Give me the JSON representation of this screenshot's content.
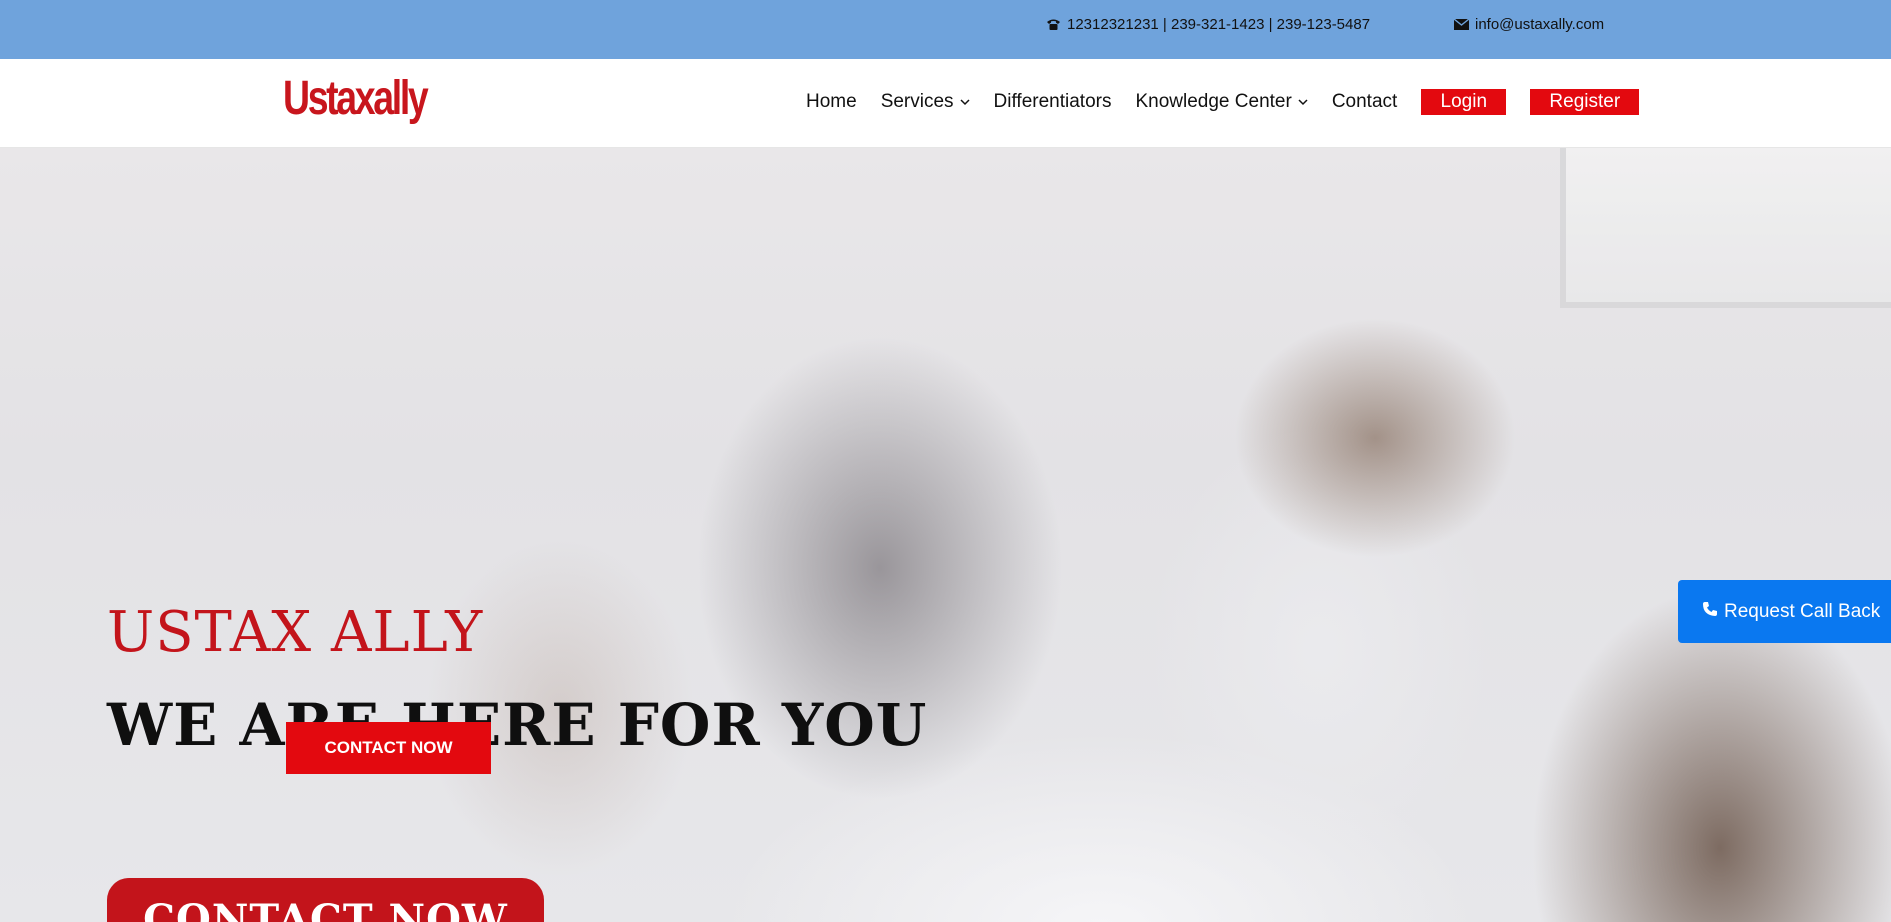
{
  "topbar": {
    "phones": "12312321231 | 239-321-1423 | 239-123-5487",
    "email": "info@ustaxally.com",
    "background_color": "#6fa3dc",
    "phone_icon": "phone-icon",
    "email_icon": "envelope-icon"
  },
  "brand": {
    "logo_text": "Ustaxally",
    "color": "#c8161d"
  },
  "nav": {
    "home": "Home",
    "services": "Services",
    "differentiators": "Differentiators",
    "knowledge_center": "Knowledge Center",
    "contact": "Contact",
    "login": "Login",
    "register": "Register",
    "dropdown_icon": "chevron-down-icon",
    "button_color": "#e3090f"
  },
  "hero": {
    "title": "USTAX ALLY",
    "subtitle": "WE ARE HERE FOR YOU",
    "contact_button_small": "CONTACT NOW",
    "contact_button_large": "CONTACT NOW",
    "title_color": "#c3141b"
  },
  "callback": {
    "label": "Request Call Back",
    "icon": "phone-icon",
    "color": "#0a78f0"
  }
}
